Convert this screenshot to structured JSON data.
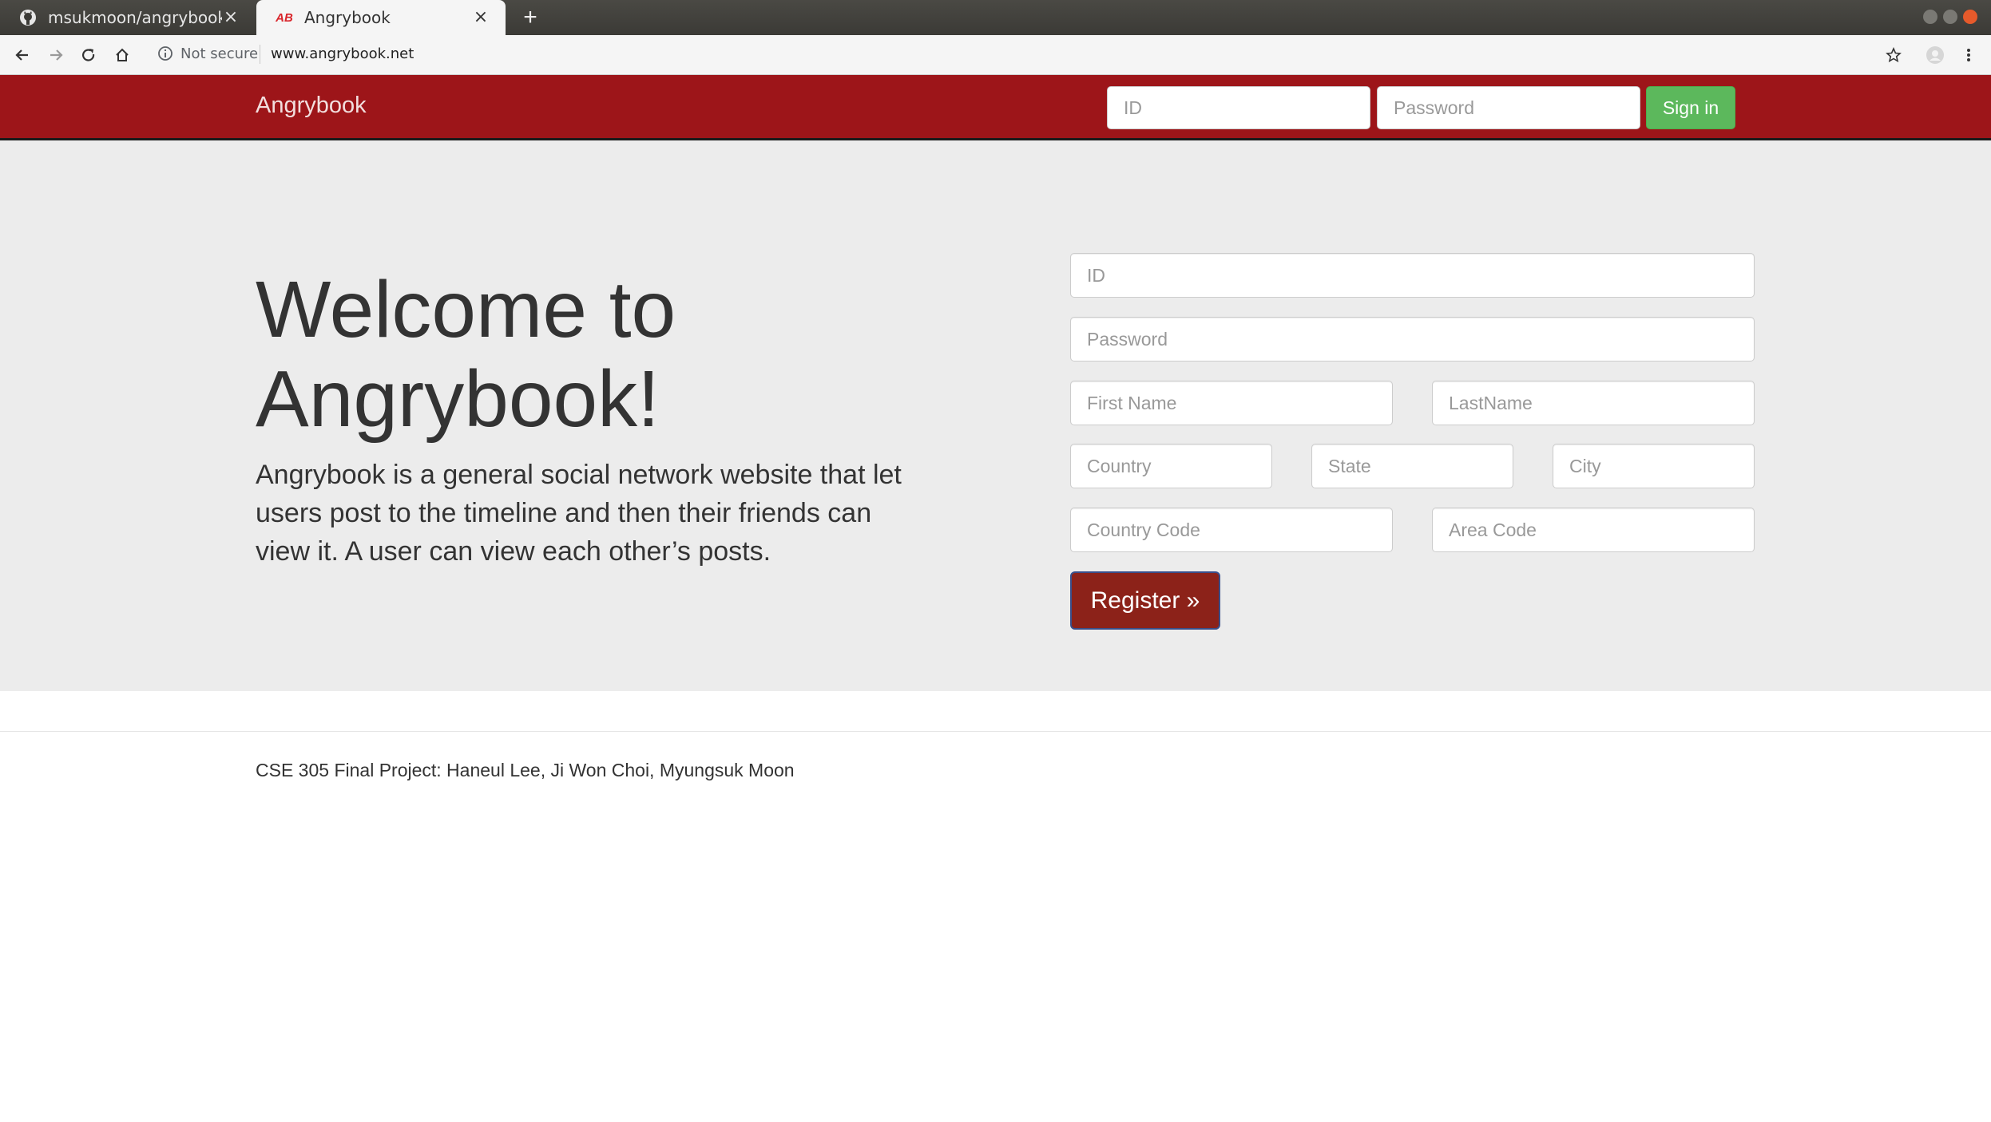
{
  "browser": {
    "tabs": [
      {
        "title": "msukmoon/angrybook",
        "favicon": "github-icon",
        "active": false
      },
      {
        "title": "Angrybook",
        "favicon": "angrybook-favicon",
        "favicon_text": "AB",
        "active": true
      }
    ],
    "security_label": "Not secure",
    "url": "www.angrybook.net"
  },
  "navbar": {
    "brand": "Angrybook",
    "id_placeholder": "ID",
    "password_placeholder": "Password",
    "signin_label": "Sign in"
  },
  "jumbotron": {
    "headline_line1": "Welcome to",
    "headline_line2": "Angrybook!",
    "lead": "Angrybook is a general social network website that let users post to the timeline and then their friends can view it. A user can view each other’s posts."
  },
  "register_form": {
    "id_placeholder": "ID",
    "password_placeholder": "Password",
    "first_name_placeholder": "First Name",
    "last_name_placeholder": "LastName",
    "country_placeholder": "Country",
    "state_placeholder": "State",
    "city_placeholder": "City",
    "country_code_placeholder": "Country Code",
    "area_code_placeholder": "Area Code",
    "register_label": "Register »"
  },
  "footer": {
    "text": "CSE 305 Final Project: Haneul Lee, Ji Won Choi, Myungsuk Moon"
  },
  "colors": {
    "navbar": "#9d1519",
    "signin": "#5cb85c",
    "register": "#8c2219",
    "jumbotron": "#ececec"
  }
}
